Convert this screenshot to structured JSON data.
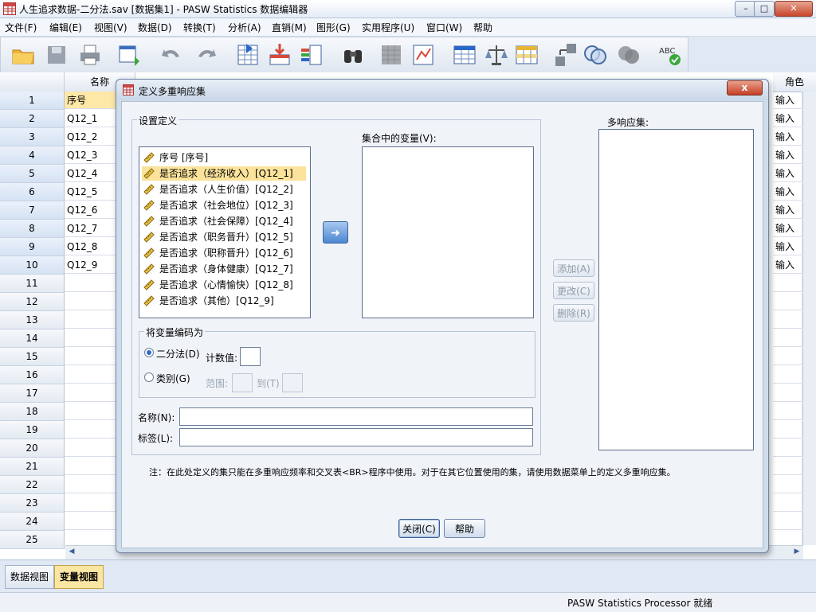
{
  "window": {
    "title": "人生追求数据-二分法.sav [数据集1] - PASW Statistics 数据编辑器",
    "minimize": "–",
    "maximize": "□",
    "close": "✕"
  },
  "menu": [
    "文件(F)",
    "编辑(E)",
    "视图(V)",
    "数据(D)",
    "转换(T)",
    "分析(A)",
    "直销(M)",
    "图形(G)",
    "实用程序(U)",
    "窗口(W)",
    "帮助"
  ],
  "toolbar": {
    "icons": [
      "open-icon",
      "save-icon",
      "print-icon",
      "recall-dialog-icon",
      "undo-icon",
      "redo-icon",
      "goto-case-icon",
      "goto-variable-icon",
      "variables-icon",
      "find-icon",
      "insert-cases-icon",
      "insert-variable-icon",
      "split-file-icon",
      "weight-cases-icon",
      "select-cases-icon",
      "value-labels-icon",
      "use-sets-icon",
      "show-sets-icon",
      "spell-check-icon"
    ]
  },
  "grid": {
    "col_name": "名称",
    "col_role": "角色",
    "rows": [
      "1",
      "2",
      "3",
      "4",
      "5",
      "6",
      "7",
      "8",
      "9",
      "10",
      "11",
      "12",
      "13",
      "14",
      "15",
      "16",
      "17",
      "18",
      "19",
      "20",
      "21",
      "22",
      "23",
      "24",
      "25"
    ],
    "names": [
      "序号",
      "Q12_1",
      "Q12_2",
      "Q12_3",
      "Q12_4",
      "Q12_5",
      "Q12_6",
      "Q12_7",
      "Q12_8",
      "Q12_9"
    ],
    "roles": [
      "输入",
      "输入",
      "输入",
      "输入",
      "输入",
      "输入",
      "输入",
      "输入",
      "输入",
      "输入"
    ]
  },
  "tabs": {
    "data_view": "数据视图",
    "variable_view": "变量视图"
  },
  "status": {
    "message": "PASW Statistics Processor 就绪"
  },
  "dialog": {
    "title": "定义多重响应集",
    "close": "x",
    "set_definition_label": "设置定义",
    "source_vars": [
      {
        "label": "序号 [序号]"
      },
      {
        "label": "是否追求（经济收入）[Q12_1]"
      },
      {
        "label": "是否追求（人生价值）[Q12_2]"
      },
      {
        "label": "是否追求（社会地位）[Q12_3]"
      },
      {
        "label": "是否追求（社会保障）[Q12_4]"
      },
      {
        "label": "是否追求（职务晋升）[Q12_5]"
      },
      {
        "label": "是否追求（职称晋升）[Q12_6]"
      },
      {
        "label": "是否追求（身体健康）[Q12_7]"
      },
      {
        "label": "是否追求（心情愉快）[Q12_8]"
      },
      {
        "label": "是否追求（其他）[Q12_9]"
      }
    ],
    "selected_index": 1,
    "vars_in_set_label": "集合中的变量(V):",
    "move_arrow": "➜",
    "encode_label": "将变量编码为",
    "dichotomy_label": "二分法(D)",
    "counted_value_label": "计数值:",
    "categories_label": "类别(G)",
    "range_label": "范围:",
    "to_label": "到(T)",
    "name_label": "名称(N):",
    "label_label": "标签(L):",
    "add_button": "添加(A)",
    "change_button": "更改(C)",
    "remove_button": "删除(R)",
    "mr_sets_label": "多响应集:",
    "note": "注：在此处定义的集只能在多重响应频率和交叉表<BR>程序中使用。对于在其它位置使用的集，请使用数据菜单上的定义多重响应集。",
    "close_button": "关闭(C)",
    "help_button": "帮助"
  }
}
